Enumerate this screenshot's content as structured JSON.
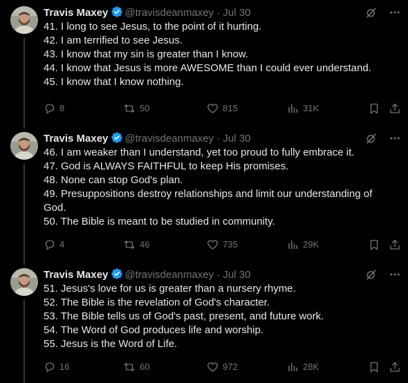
{
  "tweets": [
    {
      "author": "Travis Maxey",
      "handle": "@travisdeanmaxey",
      "separator": "·",
      "date": "Jul 30",
      "lines": [
        "41. I long to see Jesus, to the point of it hurting.",
        "42. I am terrified to see Jesus.",
        "43. I know that my sin is greater than I know.",
        "44. I know that Jesus is more AWESOME than I could ever understand.",
        "45. I know that I know nothing."
      ],
      "replies": "8",
      "retweets": "50",
      "likes": "815",
      "views": "31K"
    },
    {
      "author": "Travis Maxey",
      "handle": "@travisdeanmaxey",
      "separator": "·",
      "date": "Jul 30",
      "lines": [
        "46. I am weaker than I understand, yet too proud to fully embrace it.",
        "47. God is ALWAYS FAITHFUL to keep His promises.",
        "48. None can stop God's plan.",
        "49. Presuppositions destroy relationships and limit our understanding of",
        "God.",
        "50. The Bible is meant to be studied in community."
      ],
      "replies": "4",
      "retweets": "46",
      "likes": "735",
      "views": "29K"
    },
    {
      "author": "Travis Maxey",
      "handle": "@travisdeanmaxey",
      "separator": "·",
      "date": "Jul 30",
      "lines": [
        "51. Jesus's love for us is greater than a nursery rhyme.",
        "52. The Bible is the revelation of God's character.",
        "53. The Bible tells us of God's past, present, and future work.",
        "54. The Word of God produces life and worship.",
        "55. Jesus is the Word of Life."
      ],
      "replies": "16",
      "retweets": "60",
      "likes": "972",
      "views": "28K"
    }
  ],
  "colors": {
    "background": "#000000",
    "text": "#e7e9ea",
    "muted": "#71767b",
    "verified": "#1d9bf0",
    "thread_line": "#333639"
  },
  "icons": [
    "grok-icon",
    "more-icon",
    "reply-icon",
    "retweet-icon",
    "like-icon",
    "views-icon",
    "bookmark-icon",
    "share-icon",
    "verified-badge-icon"
  ]
}
